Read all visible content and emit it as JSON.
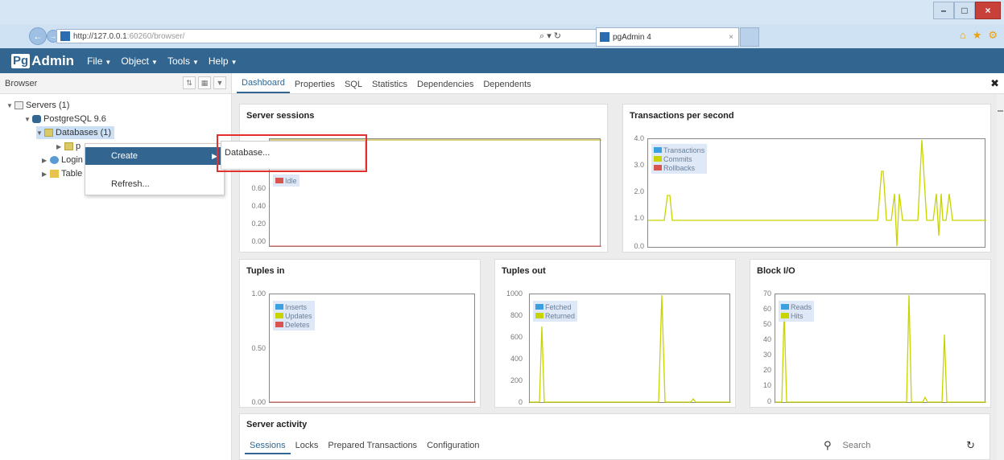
{
  "browser_url": {
    "host": "http://127.0.0.1",
    "rest": ":60260/browser/"
  },
  "search_controls": "⌕ ▾ ↻",
  "ie_tab_title": "pgAdmin 4",
  "ie_tab_close": "×",
  "window_controls": {
    "min": "–",
    "max": "□",
    "close": "×"
  },
  "nav": {
    "brand_pg": "Pg",
    "brand_admin": "Admin",
    "menus": [
      {
        "label": "File"
      },
      {
        "label": "Object"
      },
      {
        "label": "Tools"
      },
      {
        "label": "Help"
      }
    ]
  },
  "browser_panel": {
    "title": "Browser"
  },
  "tree": {
    "servers": "Servers (1)",
    "server": "PostgreSQL 9.6",
    "databases": "Databases (1)",
    "db_child": "p",
    "login_roles": "Login",
    "tablespaces": "Table"
  },
  "context_menu": {
    "create": "Create",
    "refresh": "Refresh..."
  },
  "submenu": {
    "database": "Database..."
  },
  "tabs": [
    "Dashboard",
    "Properties",
    "SQL",
    "Statistics",
    "Dependencies",
    "Dependents"
  ],
  "cards": {
    "server_sessions": "Server sessions",
    "tps": "Transactions per second",
    "tuples_in": "Tuples in",
    "tuples_out": "Tuples out",
    "block_io": "Block I/O"
  },
  "charts": {
    "server_sessions": {
      "ticks": [
        "0.60",
        "0.40",
        "0.20",
        "0.00"
      ],
      "legend": [
        {
          "label": "Idle",
          "color": "#d9534f"
        }
      ]
    },
    "tps": {
      "ticks": [
        "4.0",
        "3.0",
        "2.0",
        "1.0",
        "0.0"
      ],
      "legend": [
        {
          "label": "Transactions",
          "color": "#3aa0e0"
        },
        {
          "label": "Commits",
          "color": "#c8d400"
        },
        {
          "label": "Rollbacks",
          "color": "#d9534f"
        }
      ]
    },
    "tuples_in": {
      "ticks": [
        "1.00",
        "0.50",
        "0.00"
      ],
      "legend": [
        {
          "label": "Inserts",
          "color": "#3aa0e0"
        },
        {
          "label": "Updates",
          "color": "#c8d400"
        },
        {
          "label": "Deletes",
          "color": "#d9534f"
        }
      ]
    },
    "tuples_out": {
      "ticks": [
        "1000",
        "800",
        "600",
        "400",
        "200",
        "0"
      ],
      "legend": [
        {
          "label": "Fetched",
          "color": "#3aa0e0"
        },
        {
          "label": "Returned",
          "color": "#c8d400"
        }
      ]
    },
    "block_io": {
      "ticks": [
        "70",
        "60",
        "50",
        "40",
        "30",
        "20",
        "10",
        "0"
      ],
      "legend": [
        {
          "label": "Reads",
          "color": "#3aa0e0"
        },
        {
          "label": "Hits",
          "color": "#c8d400"
        }
      ]
    }
  },
  "activity": {
    "title": "Server activity",
    "tabs": [
      "Sessions",
      "Locks",
      "Prepared Transactions",
      "Configuration"
    ],
    "search_placeholder": "Search"
  }
}
